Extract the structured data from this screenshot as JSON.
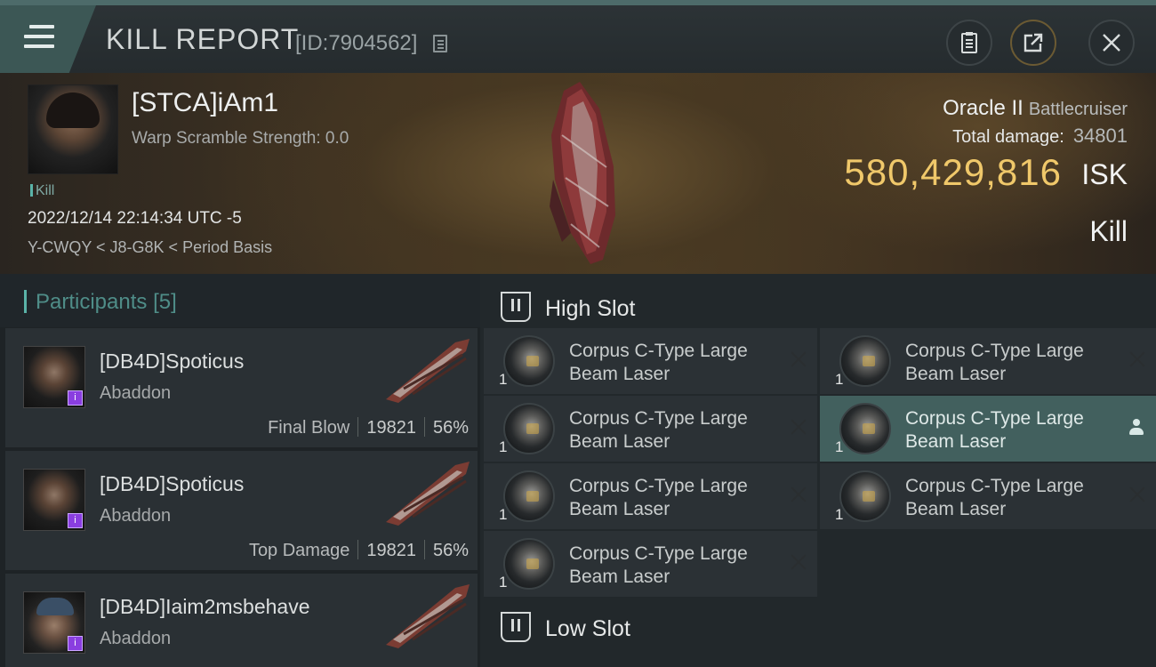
{
  "header": {
    "title": "KILL REPORT",
    "report_id": "[ID:7904562]"
  },
  "victim": {
    "name": "[STCA]iAm1",
    "warp_scramble": "Warp Scramble Strength: 0.0",
    "tag": "Kill",
    "datetime": "2022/12/14 22:14:34 UTC -5",
    "location": "Y-CWQY < J8-G8K < Period Basis",
    "ship_name": "Oracle II",
    "ship_class": "Battlecruiser",
    "total_damage_label": "Total damage:",
    "total_damage": "34801",
    "isk_value": "580,429,816",
    "isk_unit": "ISK",
    "result": "Kill"
  },
  "participants": {
    "title": "Participants",
    "count": "[5]",
    "rows": [
      {
        "name": "[DB4D]Spoticus",
        "ship": "Abaddon",
        "label": "Final Blow",
        "damage": "19821",
        "percent": "56%"
      },
      {
        "name": "[DB4D]Spoticus",
        "ship": "Abaddon",
        "label": "Top Damage",
        "damage": "19821",
        "percent": "56%"
      },
      {
        "name": "[DB4D]Iaim2msbehave",
        "ship": "Abaddon",
        "label": "",
        "damage": "",
        "percent": ""
      }
    ]
  },
  "slots": {
    "high_title": "High Slot",
    "low_title": "Low Slot",
    "high_modules": [
      {
        "name": "Corpus C-Type Large Beam Laser",
        "qty": "1"
      },
      {
        "name": "Corpus C-Type Large Beam Laser",
        "qty": "1"
      },
      {
        "name": "Corpus C-Type Large Beam Laser",
        "qty": "1"
      },
      {
        "name": "Corpus C-Type Large Beam Laser",
        "qty": "1"
      },
      {
        "name": "Corpus C-Type Large Beam Laser",
        "qty": "1"
      },
      {
        "name": "Corpus C-Type Large Beam Laser",
        "qty": "1"
      },
      {
        "name": "Corpus C-Type Large Beam Laser",
        "qty": "1"
      }
    ]
  },
  "colors": {
    "accent": "#5ab3a8",
    "isk": "#f0c86a",
    "highlight_row": "#42605e",
    "pilot_badge": "#8a3ee0"
  },
  "icons": {
    "menu": "hamburger-icon",
    "copy": "copy-icon",
    "clipboard": "clipboard-icon",
    "share": "share-icon",
    "close": "close-icon",
    "slot": "slot-icon",
    "destroyed": "x-icon",
    "pilot": "user-icon"
  }
}
